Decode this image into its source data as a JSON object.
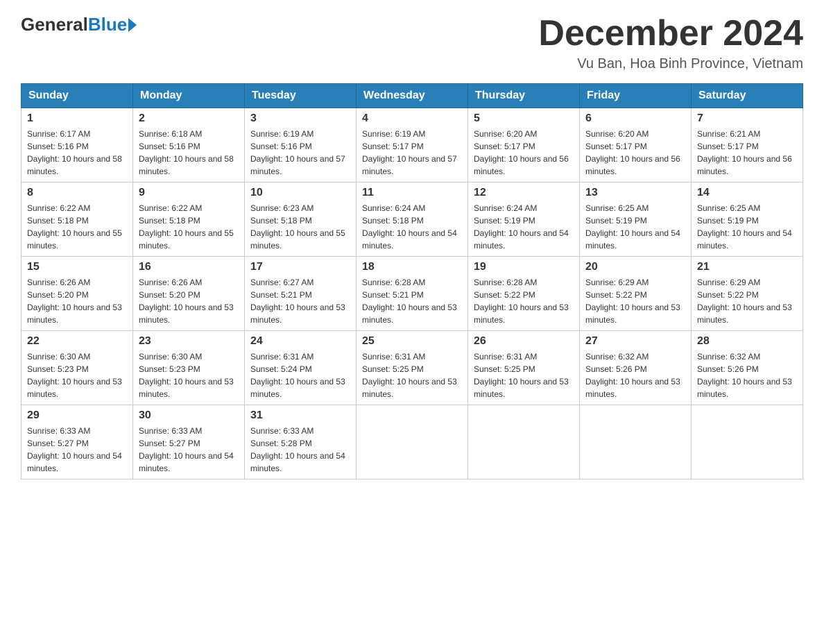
{
  "header": {
    "logo": {
      "general": "General",
      "blue": "Blue"
    },
    "title": "December 2024",
    "location": "Vu Ban, Hoa Binh Province, Vietnam"
  },
  "weekdays": [
    "Sunday",
    "Monday",
    "Tuesday",
    "Wednesday",
    "Thursday",
    "Friday",
    "Saturday"
  ],
  "weeks": [
    [
      {
        "day": "1",
        "sunrise": "6:17 AM",
        "sunset": "5:16 PM",
        "daylight": "10 hours and 58 minutes."
      },
      {
        "day": "2",
        "sunrise": "6:18 AM",
        "sunset": "5:16 PM",
        "daylight": "10 hours and 58 minutes."
      },
      {
        "day": "3",
        "sunrise": "6:19 AM",
        "sunset": "5:16 PM",
        "daylight": "10 hours and 57 minutes."
      },
      {
        "day": "4",
        "sunrise": "6:19 AM",
        "sunset": "5:17 PM",
        "daylight": "10 hours and 57 minutes."
      },
      {
        "day": "5",
        "sunrise": "6:20 AM",
        "sunset": "5:17 PM",
        "daylight": "10 hours and 56 minutes."
      },
      {
        "day": "6",
        "sunrise": "6:20 AM",
        "sunset": "5:17 PM",
        "daylight": "10 hours and 56 minutes."
      },
      {
        "day": "7",
        "sunrise": "6:21 AM",
        "sunset": "5:17 PM",
        "daylight": "10 hours and 56 minutes."
      }
    ],
    [
      {
        "day": "8",
        "sunrise": "6:22 AM",
        "sunset": "5:18 PM",
        "daylight": "10 hours and 55 minutes."
      },
      {
        "day": "9",
        "sunrise": "6:22 AM",
        "sunset": "5:18 PM",
        "daylight": "10 hours and 55 minutes."
      },
      {
        "day": "10",
        "sunrise": "6:23 AM",
        "sunset": "5:18 PM",
        "daylight": "10 hours and 55 minutes."
      },
      {
        "day": "11",
        "sunrise": "6:24 AM",
        "sunset": "5:18 PM",
        "daylight": "10 hours and 54 minutes."
      },
      {
        "day": "12",
        "sunrise": "6:24 AM",
        "sunset": "5:19 PM",
        "daylight": "10 hours and 54 minutes."
      },
      {
        "day": "13",
        "sunrise": "6:25 AM",
        "sunset": "5:19 PM",
        "daylight": "10 hours and 54 minutes."
      },
      {
        "day": "14",
        "sunrise": "6:25 AM",
        "sunset": "5:19 PM",
        "daylight": "10 hours and 54 minutes."
      }
    ],
    [
      {
        "day": "15",
        "sunrise": "6:26 AM",
        "sunset": "5:20 PM",
        "daylight": "10 hours and 53 minutes."
      },
      {
        "day": "16",
        "sunrise": "6:26 AM",
        "sunset": "5:20 PM",
        "daylight": "10 hours and 53 minutes."
      },
      {
        "day": "17",
        "sunrise": "6:27 AM",
        "sunset": "5:21 PM",
        "daylight": "10 hours and 53 minutes."
      },
      {
        "day": "18",
        "sunrise": "6:28 AM",
        "sunset": "5:21 PM",
        "daylight": "10 hours and 53 minutes."
      },
      {
        "day": "19",
        "sunrise": "6:28 AM",
        "sunset": "5:22 PM",
        "daylight": "10 hours and 53 minutes."
      },
      {
        "day": "20",
        "sunrise": "6:29 AM",
        "sunset": "5:22 PM",
        "daylight": "10 hours and 53 minutes."
      },
      {
        "day": "21",
        "sunrise": "6:29 AM",
        "sunset": "5:22 PM",
        "daylight": "10 hours and 53 minutes."
      }
    ],
    [
      {
        "day": "22",
        "sunrise": "6:30 AM",
        "sunset": "5:23 PM",
        "daylight": "10 hours and 53 minutes."
      },
      {
        "day": "23",
        "sunrise": "6:30 AM",
        "sunset": "5:23 PM",
        "daylight": "10 hours and 53 minutes."
      },
      {
        "day": "24",
        "sunrise": "6:31 AM",
        "sunset": "5:24 PM",
        "daylight": "10 hours and 53 minutes."
      },
      {
        "day": "25",
        "sunrise": "6:31 AM",
        "sunset": "5:25 PM",
        "daylight": "10 hours and 53 minutes."
      },
      {
        "day": "26",
        "sunrise": "6:31 AM",
        "sunset": "5:25 PM",
        "daylight": "10 hours and 53 minutes."
      },
      {
        "day": "27",
        "sunrise": "6:32 AM",
        "sunset": "5:26 PM",
        "daylight": "10 hours and 53 minutes."
      },
      {
        "day": "28",
        "sunrise": "6:32 AM",
        "sunset": "5:26 PM",
        "daylight": "10 hours and 53 minutes."
      }
    ],
    [
      {
        "day": "29",
        "sunrise": "6:33 AM",
        "sunset": "5:27 PM",
        "daylight": "10 hours and 54 minutes."
      },
      {
        "day": "30",
        "sunrise": "6:33 AM",
        "sunset": "5:27 PM",
        "daylight": "10 hours and 54 minutes."
      },
      {
        "day": "31",
        "sunrise": "6:33 AM",
        "sunset": "5:28 PM",
        "daylight": "10 hours and 54 minutes."
      },
      null,
      null,
      null,
      null
    ]
  ]
}
